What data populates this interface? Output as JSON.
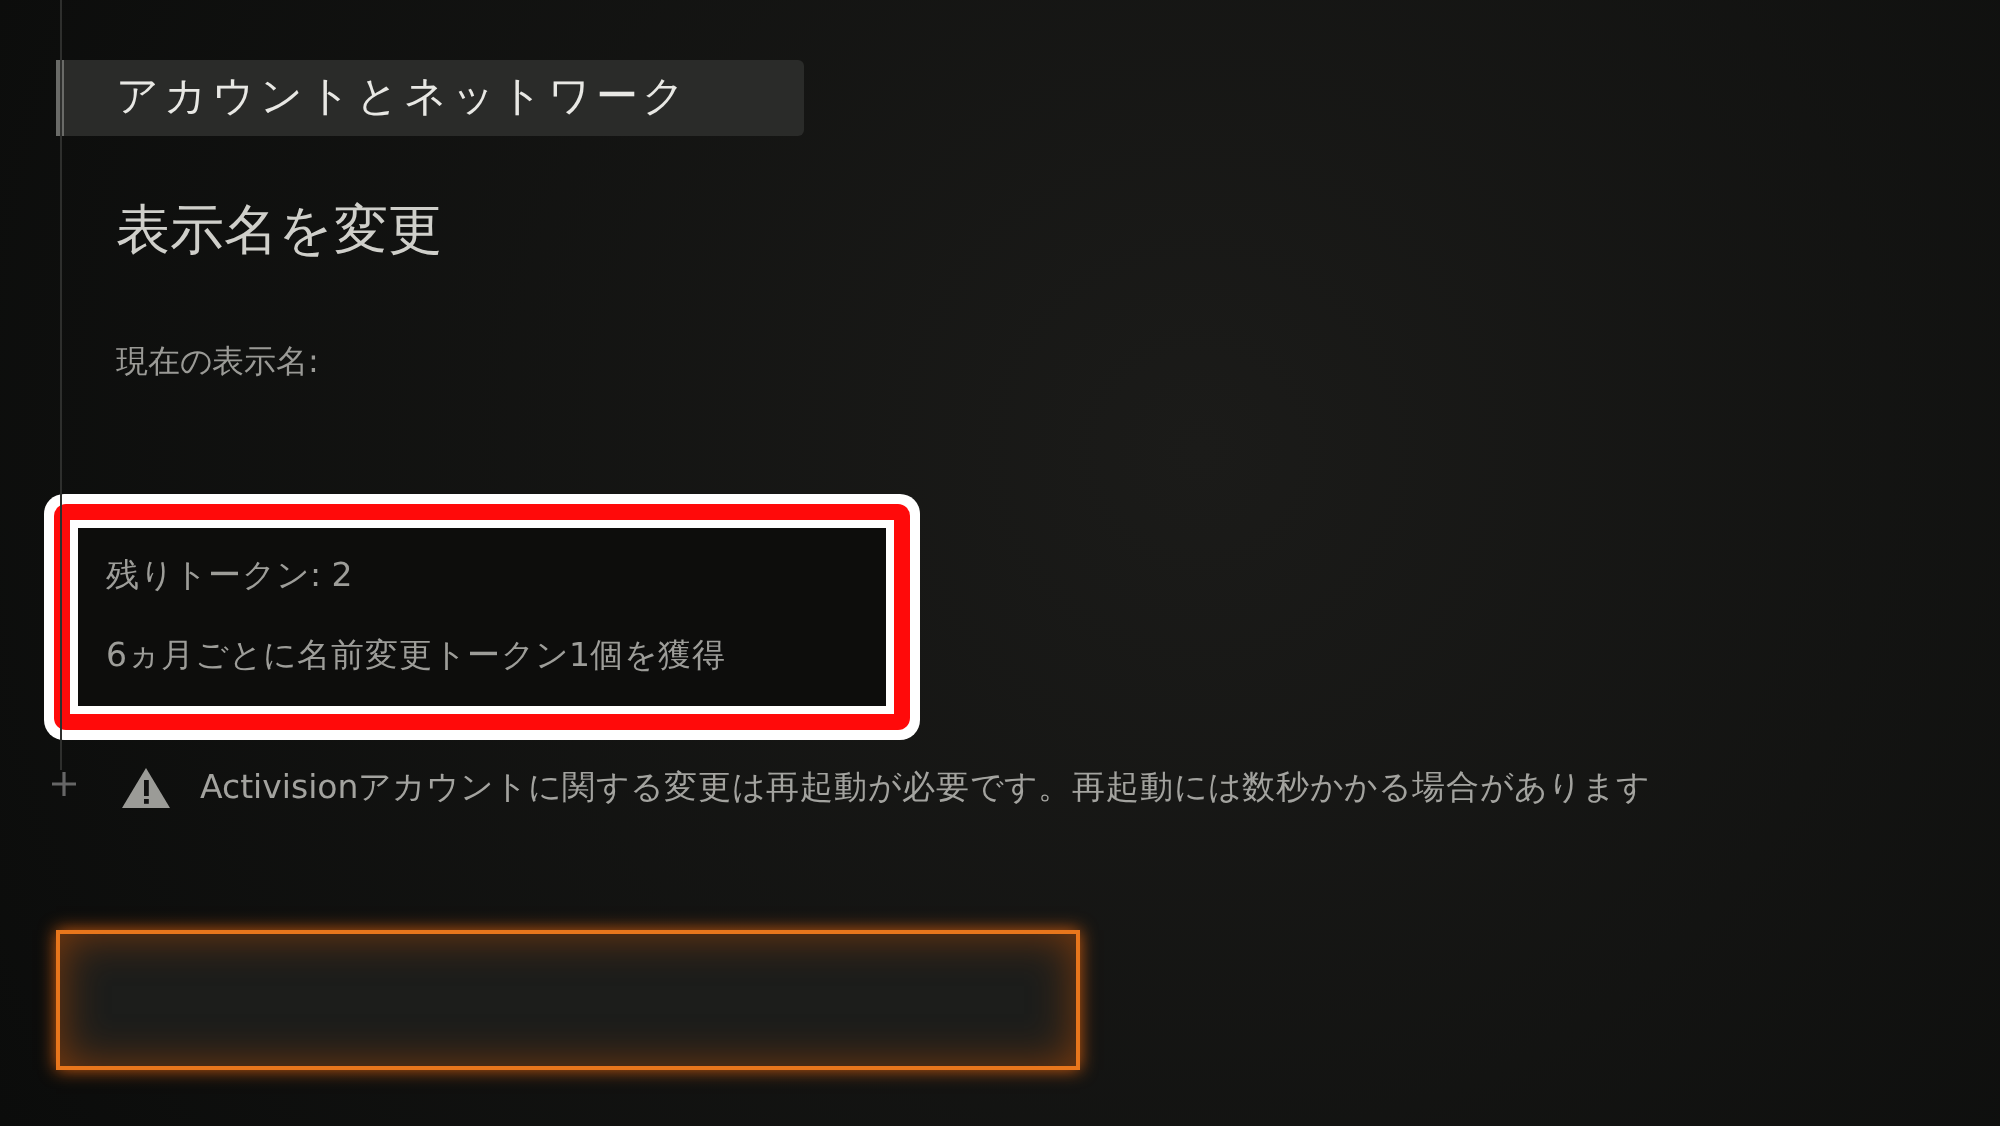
{
  "section_header": {
    "title": "アカウントとネットワーク"
  },
  "page_title": "表示名を変更",
  "current_name_label": "現在の表示名:",
  "token_info": {
    "highlighted": true,
    "lines": [
      "残りトークン: 2",
      "6ヵ月ごとに名前変更トークン1個を獲得"
    ]
  },
  "warning": {
    "text": "Activisionアカウントに関する変更は再起動が必要です。再起動には数秒かかる場合があります"
  },
  "name_field": {
    "focused": true
  }
}
